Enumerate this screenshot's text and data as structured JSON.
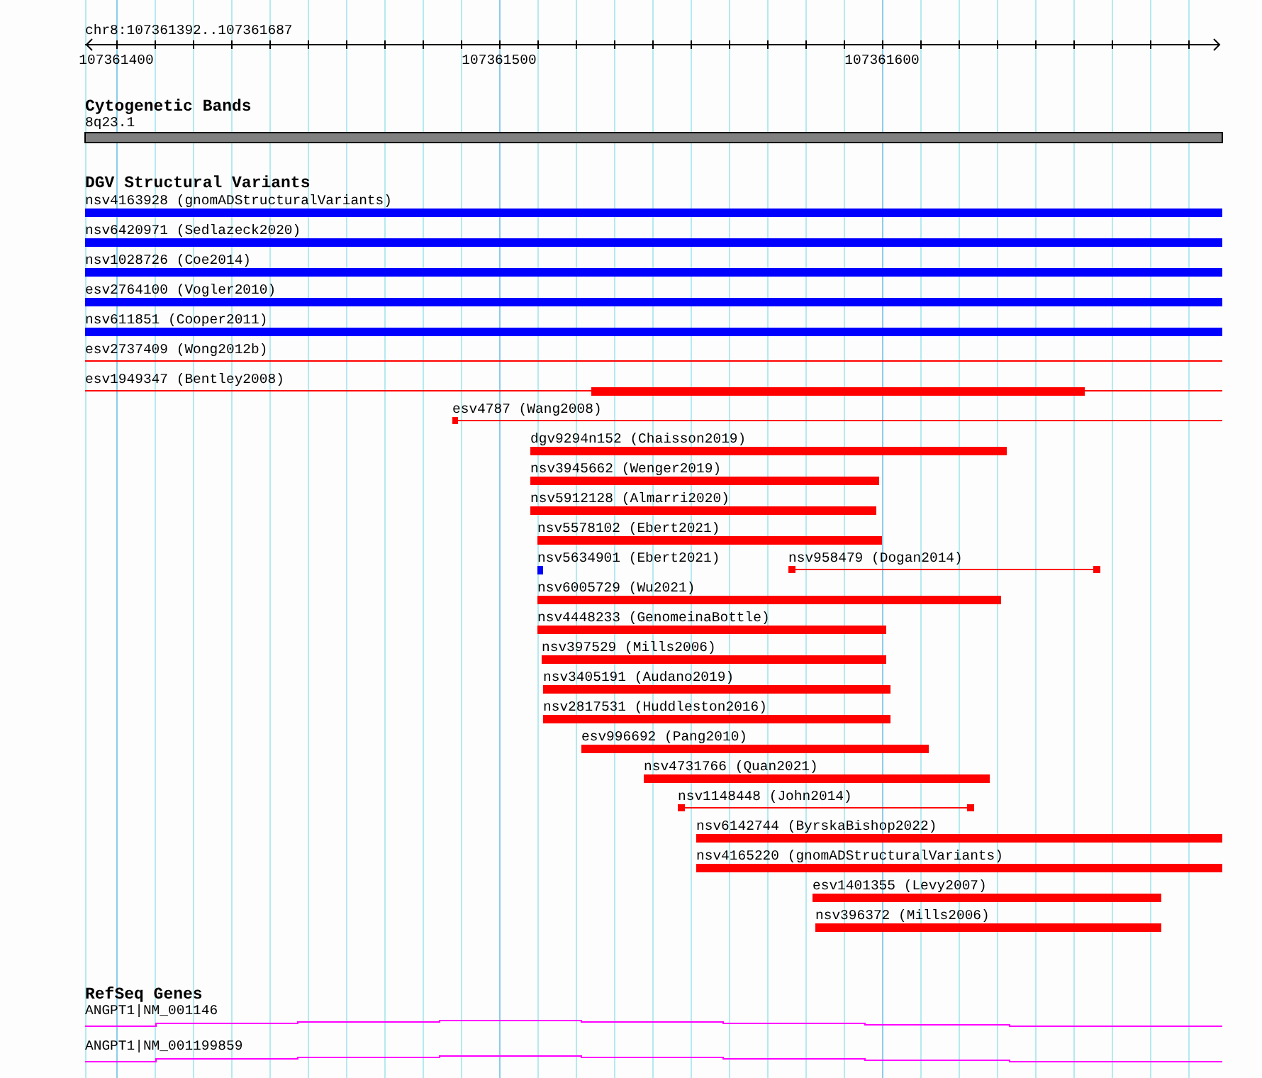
{
  "ruler": {
    "location": "chr8:107361392..107361687",
    "tick_labels": [
      "107361400",
      "107361500",
      "107361600"
    ]
  },
  "cytogenetic_bands": {
    "title": "Cytogenetic Bands",
    "band": {
      "label": "8q23.1"
    }
  },
  "dgv_structural_variants": {
    "title": "DGV Structural Variants",
    "variants": [
      {
        "label": "nsv4163928 (gnomADStructuralVariants)",
        "color": "#0000ff"
      },
      {
        "label": "nsv6420971 (Sedlazeck2020)",
        "color": "#0000ff"
      },
      {
        "label": "nsv1028726 (Coe2014)",
        "color": "#0000ff"
      },
      {
        "label": "esv2764100 (Vogler2010)",
        "color": "#0000ff"
      },
      {
        "label": "nsv611851 (Cooper2011)",
        "color": "#0000ff"
      },
      {
        "label": "esv2737409 (Wong2012b)",
        "color": "#ff0000"
      },
      {
        "label": "esv1949347 (Bentley2008)",
        "color": "#ff0000"
      },
      {
        "label": "esv4787 (Wang2008)",
        "color": "#ff0000"
      },
      {
        "label": "dgv9294n152 (Chaisson2019)",
        "color": "#ff0000"
      },
      {
        "label": "nsv3945662 (Wenger2019)",
        "color": "#ff0000"
      },
      {
        "label": "nsv5912128 (Almarri2020)",
        "color": "#ff0000"
      },
      {
        "label": "nsv5578102 (Ebert2021)",
        "color": "#ff0000"
      },
      {
        "label": "nsv5634901 (Ebert2021)",
        "color": "#0000ff"
      },
      {
        "label": "nsv958479 (Dogan2014)",
        "color": "#ff0000"
      },
      {
        "label": "nsv6005729 (Wu2021)",
        "color": "#ff0000"
      },
      {
        "label": "nsv4448233 (GenomeinaBottle)",
        "color": "#ff0000"
      },
      {
        "label": "nsv397529 (Mills2006)",
        "color": "#ff0000"
      },
      {
        "label": "nsv3405191 (Audano2019)",
        "color": "#ff0000"
      },
      {
        "label": "nsv2817531 (Huddleston2016)",
        "color": "#ff0000"
      },
      {
        "label": "esv996692 (Pang2010)",
        "color": "#ff0000"
      },
      {
        "label": "nsv4731766 (Quan2021)",
        "color": "#ff0000"
      },
      {
        "label": "nsv1148448 (John2014)",
        "color": "#ff0000"
      },
      {
        "label": "nsv6142744 (ByrskaBishop2022)",
        "color": "#ff0000"
      },
      {
        "label": "nsv4165220 (gnomADStructuralVariants)",
        "color": "#ff0000"
      },
      {
        "label": "esv1401355 (Levy2007)",
        "color": "#ff0000"
      },
      {
        "label": "nsv396372 (Mills2006)",
        "color": "#ff0000"
      }
    ]
  },
  "refseq_genes": {
    "title": "RefSeq Genes",
    "genes": [
      {
        "label": "ANGPT1|NM_001146"
      },
      {
        "label": "ANGPT1|NM_001199859"
      }
    ]
  }
}
